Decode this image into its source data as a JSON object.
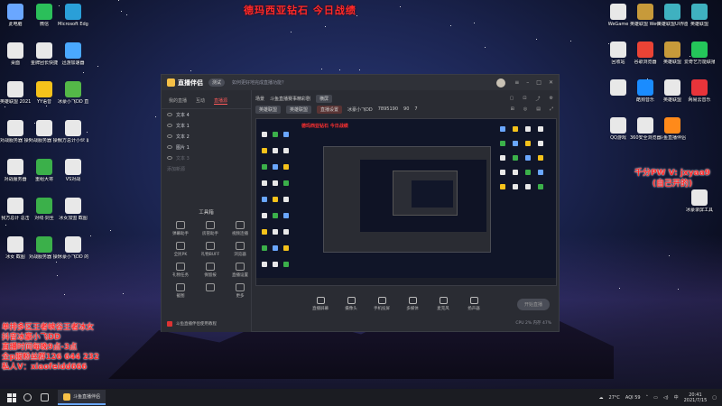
{
  "colors": {
    "overlay_red": "#ff2a2a",
    "accent_orange": "#f6c046"
  },
  "desktop": {
    "banner": "德玛西亚钻石 今日战绩",
    "left_icons": [
      {
        "label": "此电脑",
        "color": "#6aa7ff",
        "icon": "computer-icon"
      },
      {
        "label": "微信",
        "color": "#2bbf5a",
        "icon": "wechat-icon"
      },
      {
        "label": "Microsoft Edge",
        "color": "#2a9fd8",
        "icon": "edge-icon"
      },
      {
        "label": "桌面",
        "color": "#e8e8e8",
        "icon": "file-icon"
      },
      {
        "label": "金牌团长快捷",
        "color": "#e8e8e8",
        "icon": "file-icon"
      },
      {
        "label": "迅游加速器",
        "color": "#4aa8ff",
        "icon": "app-icon"
      },
      {
        "label": "英雄联盟 2021051...",
        "color": "#e8e8e8",
        "icon": "file-icon"
      },
      {
        "label": "YY语音",
        "color": "#f5c21b",
        "icon": "yy-icon"
      },
      {
        "label": "冰豪小飞DD 直播_英雄...",
        "color": "#54b848",
        "icon": "app-icon"
      },
      {
        "label": "对战服务器 操作开团...",
        "color": "#e8e8e8",
        "icon": "file-icon"
      },
      {
        "label": "对战服务器 操作开团...",
        "color": "#e8e8e8",
        "icon": "file-icon"
      },
      {
        "label": "我方总计小伙 最后一波开团",
        "color": "#e8e8e8",
        "icon": "file-icon"
      },
      {
        "label": "对战服务器",
        "color": "#e8e8e8",
        "icon": "file-icon"
      },
      {
        "label": "重组大将",
        "color": "#3bb04a",
        "icon": "app-icon"
      },
      {
        "label": "VS对战",
        "color": "#e8e8e8",
        "icon": "file-icon"
      },
      {
        "label": "我方总计 总击",
        "color": "#e8e8e8",
        "icon": "file-icon"
      },
      {
        "label": "对线·剑圣",
        "color": "#3bb04a",
        "icon": "app-icon"
      },
      {
        "label": "冰女加盟 截图",
        "color": "#e8e8e8",
        "icon": "file-icon"
      },
      {
        "label": "冰女 截图",
        "color": "#e8e8e8",
        "icon": "file-icon"
      },
      {
        "label": "对战服务器 操作开团...",
        "color": "#3bb04a",
        "icon": "app-icon"
      },
      {
        "label": "冰豪小飞DD 的刷屏...",
        "color": "#e8e8e8",
        "icon": "file-icon"
      }
    ],
    "right_icons": [
      {
        "label": "WeGame",
        "color": "#e8e8e8",
        "icon": "file-icon"
      },
      {
        "label": "英雄联盟 WeGame版",
        "color": "#c79a3a",
        "icon": "lol-icon"
      },
      {
        "label": "英雄联盟UI界面",
        "color": "#3fb1c0",
        "icon": "app-icon"
      },
      {
        "label": "英雄联盟",
        "color": "#3fb1c0",
        "icon": "app-icon"
      },
      {
        "label": "回收站",
        "color": "#e8e8e8",
        "icon": "recycle-icon"
      },
      {
        "label": "谷歌浏览器",
        "color": "#ea4335",
        "icon": "chrome-icon"
      },
      {
        "label": "英雄联盟",
        "color": "#c79a3a",
        "icon": "lol-icon"
      },
      {
        "label": "爱奇艺万能联播",
        "color": "#24c65a",
        "icon": "app-icon"
      },
      {
        "label": "",
        "color": "#e8e8e8",
        "icon": "file-icon"
      },
      {
        "label": "酷狗音乐",
        "color": "#1a8cff",
        "icon": "kugou-icon"
      },
      {
        "label": "英雄联盟",
        "color": "#e8e8e8",
        "icon": "file-icon"
      },
      {
        "label": "网易云音乐",
        "color": "#e8343a",
        "icon": "app-icon"
      },
      {
        "label": "QQ游戏",
        "color": "#e8e8e8",
        "icon": "file-icon"
      },
      {
        "label": "360安全浏览器",
        "color": "#e8e8e8",
        "icon": "file-icon"
      },
      {
        "label": "斗鱼直播伴侣",
        "color": "#ff8a1a",
        "icon": "app-icon"
      },
      {
        "label": "冰豪录屏工具",
        "color": "#e8e8e8",
        "icon": "file-icon"
      }
    ],
    "overlay_right": [
      "千分PW V: jxyaa9",
      "(自己开的)"
    ],
    "overlay_left": [
      "单排多区王者峡谷王者冰女",
      "抖音冰豪小飞DD",
      "直播时间每晚9点-3点",
      "全p服粉丝群126 644 232",
      "私人V：xiaofeidd666"
    ]
  },
  "app": {
    "name": "直播伴侣",
    "version": "测试",
    "notice": "如何更好地完成直播功能？",
    "tabs": [
      "我的直播",
      "互动",
      "直播源"
    ],
    "sources": [
      "文本 4",
      "文本 1",
      "文本 2",
      "图片 1",
      "文本 3",
      "添加新源"
    ],
    "tools_title": "工具箱",
    "tools": [
      "弹幕助手",
      "房管助手",
      "视频连播",
      "全民PK",
      "礼物BUFF",
      "浏览器",
      "礼物任务",
      "保留按",
      "直播设置",
      "截图",
      "",
      "更多"
    ],
    "bottom_tool": "斗鱼直播伴侣使用教程",
    "scene": {
      "label": "场景",
      "name": "斗鱼直播赛事精彩剧",
      "tag": "横屏",
      "cat1": "英雄联盟",
      "cat2": "英雄联盟",
      "streamer": "冰豪小飞DD",
      "id": "7895190",
      "fans": "90",
      "count": "7",
      "settings_btn": "直播设置",
      "rec_btn": "画质设置"
    },
    "preview_text": "德玛西亚钻石 今日战绩",
    "controls": [
      "直播屏幕",
      "摄像头",
      "手机投屏",
      "多媒体",
      "麦克风",
      "扬声器"
    ],
    "live_button": "开始直播",
    "status": "CPU 2%  内存 47%"
  },
  "taskbar": {
    "app_label": "斗鱼直播伴侣",
    "weather": "27°C",
    "aqi": "AQI 59",
    "ime": "中",
    "time": "20:41",
    "date": "2021/7/15"
  }
}
